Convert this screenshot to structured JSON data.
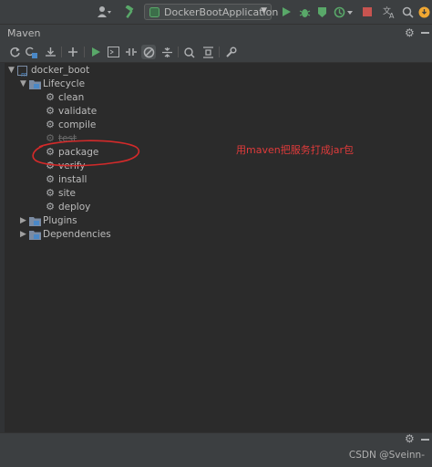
{
  "toolbar_top": {
    "run_config": "DockerBootApplication"
  },
  "panel": {
    "title": "Maven"
  },
  "tree": {
    "root": "docker_boot",
    "lifecycle_label": "Lifecycle",
    "lifecycle_items": [
      "clean",
      "validate",
      "compile",
      "test",
      "package",
      "verify",
      "install",
      "site",
      "deploy"
    ],
    "plugins_label": "Plugins",
    "dependencies_label": "Dependencies"
  },
  "annotation": "用maven把服务打成jar包",
  "watermark": "CSDN @Sveinn-",
  "colors": {
    "background": "#2b2b2b",
    "toolbar": "#3c3f41",
    "text": "#bbbbbb",
    "run_green": "#59a869",
    "stop_red": "#c75450",
    "annotation_red": "#e03b3b",
    "notification_orange": "#f0a732"
  },
  "icons": [
    "user-icon",
    "hammer-icon",
    "run-config-icon",
    "run-icon",
    "debug-icon",
    "coverage-icon",
    "profile-icon",
    "stop-icon",
    "translate-icon",
    "search-icon",
    "notification-icon",
    "settings-icon",
    "minimize-icon",
    "refresh-icon",
    "reimport-icon",
    "download-icon",
    "add-icon",
    "execute-icon",
    "toggle-offline-icon",
    "skip-tests-icon",
    "show-dependencies-icon",
    "collapse-icon",
    "wrench-icon"
  ]
}
